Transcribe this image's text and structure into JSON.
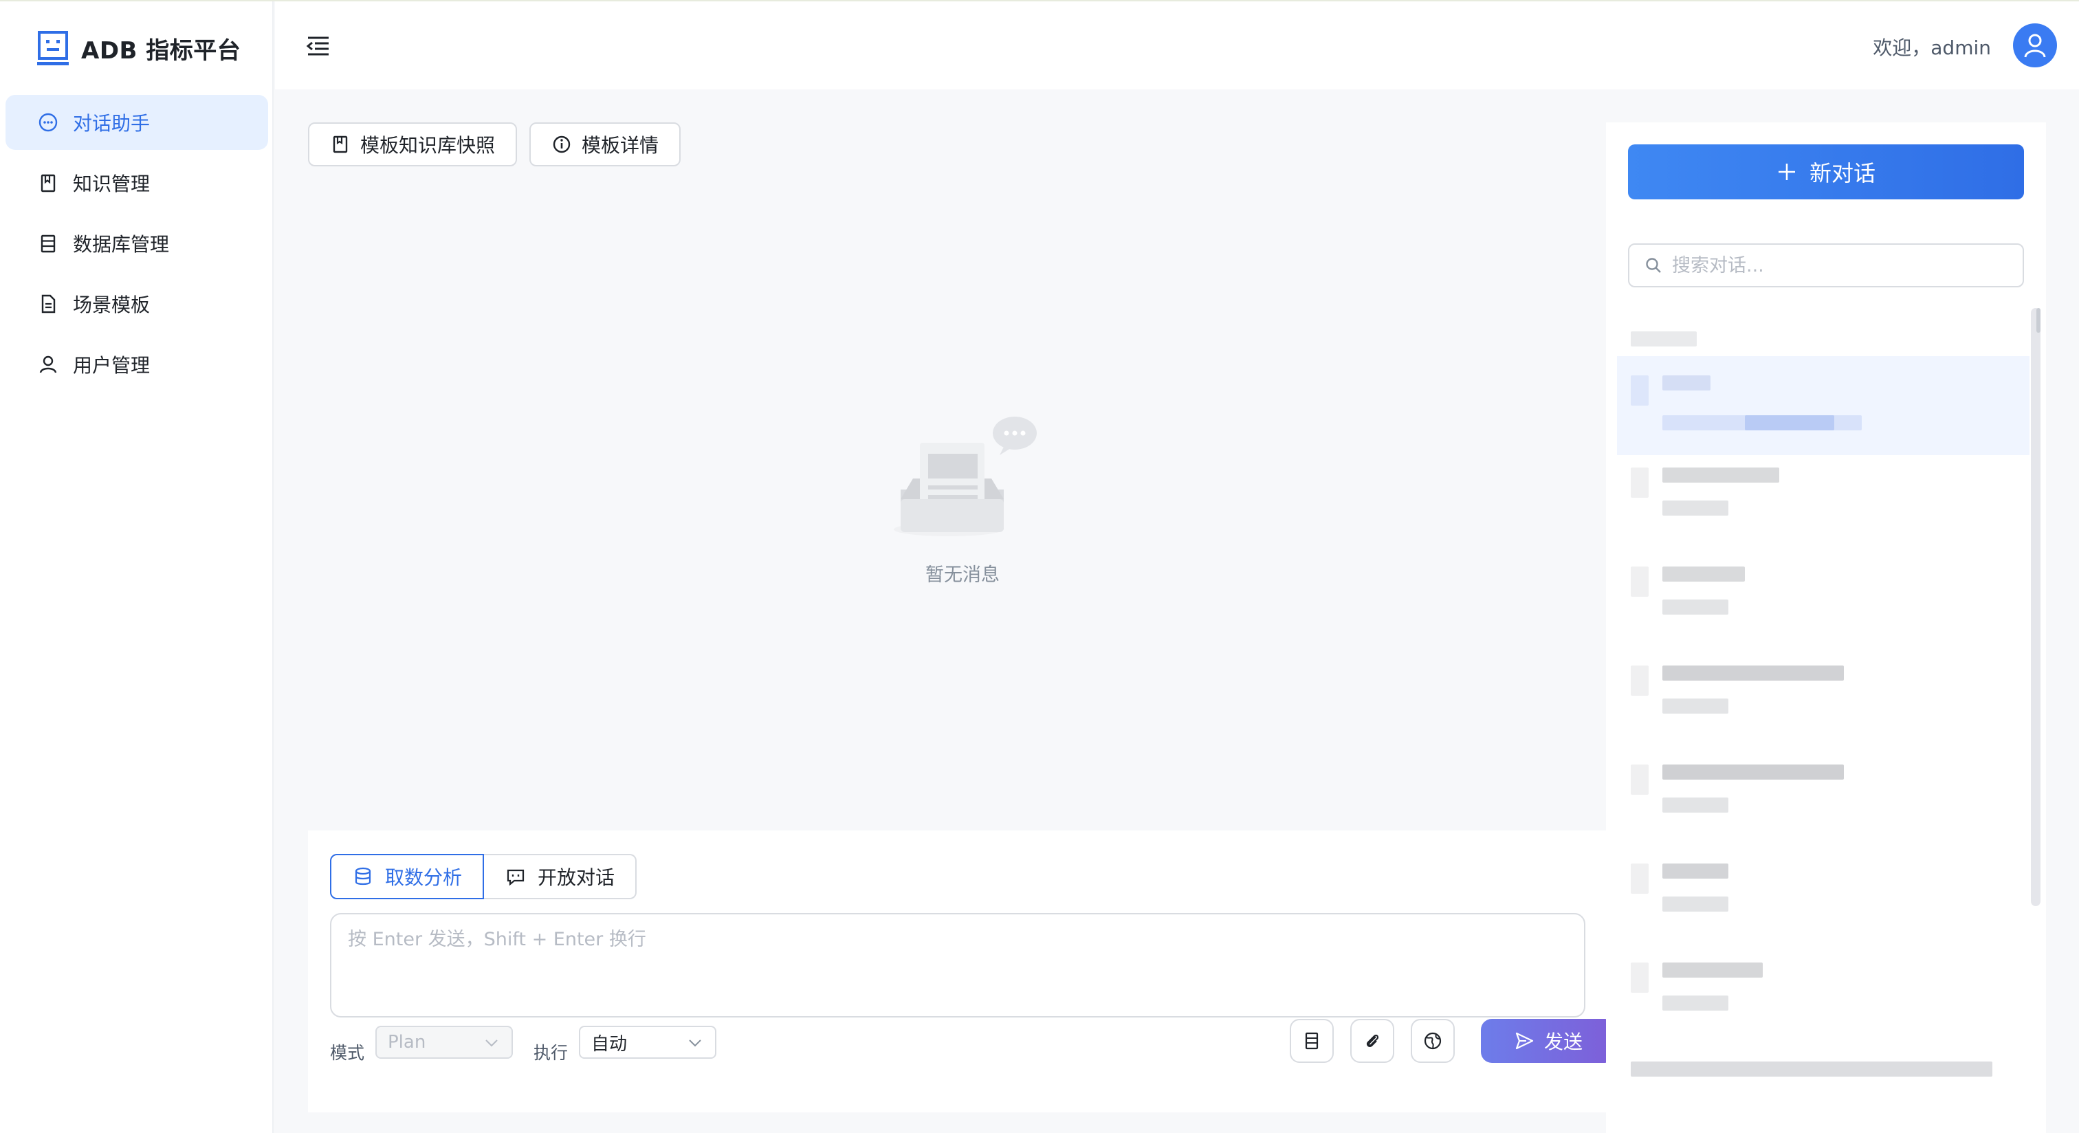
{
  "app": {
    "brand_name": "ADB 指标平台"
  },
  "sidebar": {
    "items": [
      {
        "label": "对话助手",
        "icon": "chat-bubble-icon",
        "active": true
      },
      {
        "label": "知识管理",
        "icon": "book-icon",
        "active": false
      },
      {
        "label": "数据库管理",
        "icon": "database-icon",
        "active": false
      },
      {
        "label": "场景模板",
        "icon": "document-icon",
        "active": false
      },
      {
        "label": "用户管理",
        "icon": "user-icon",
        "active": false
      }
    ]
  },
  "header": {
    "welcome": "欢迎，admin"
  },
  "toolbar": {
    "snapshot_label": "模板知识库快照",
    "details_label": "模板详情"
  },
  "empty_state": {
    "text": "暂无消息"
  },
  "composer": {
    "tabs": [
      {
        "label": "取数分析",
        "active": true
      },
      {
        "label": "开放对话",
        "active": false
      }
    ],
    "placeholder": "按 Enter 发送，Shift + Enter 换行",
    "mode_label": "模式",
    "mode_value": "Plan",
    "exec_label": "执行",
    "exec_value": "自动",
    "send_label": "发送"
  },
  "right_panel": {
    "new_chat_label": "新对话",
    "search_placeholder": "搜索对话..."
  },
  "colors": {
    "accent": "#2f6ee6",
    "send_gradient_start": "#6d7dea",
    "send_gradient_end": "#7e5ed8",
    "active_nav_bg": "#e6f0ff"
  }
}
